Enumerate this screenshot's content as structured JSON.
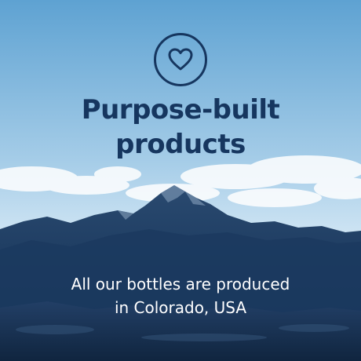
{
  "headline": {
    "line1": "Purpose-built",
    "line2": "products"
  },
  "caption": {
    "line1": "All our bottles are produced",
    "line2": "in Colorado, USA"
  },
  "icon": "heart-icon",
  "colors": {
    "headline": "#16365f",
    "caption": "#ffffff",
    "sky_top": "#5fa3d3",
    "sky_bottom": "#d6e9f5",
    "mountains": "#1d3d63"
  }
}
